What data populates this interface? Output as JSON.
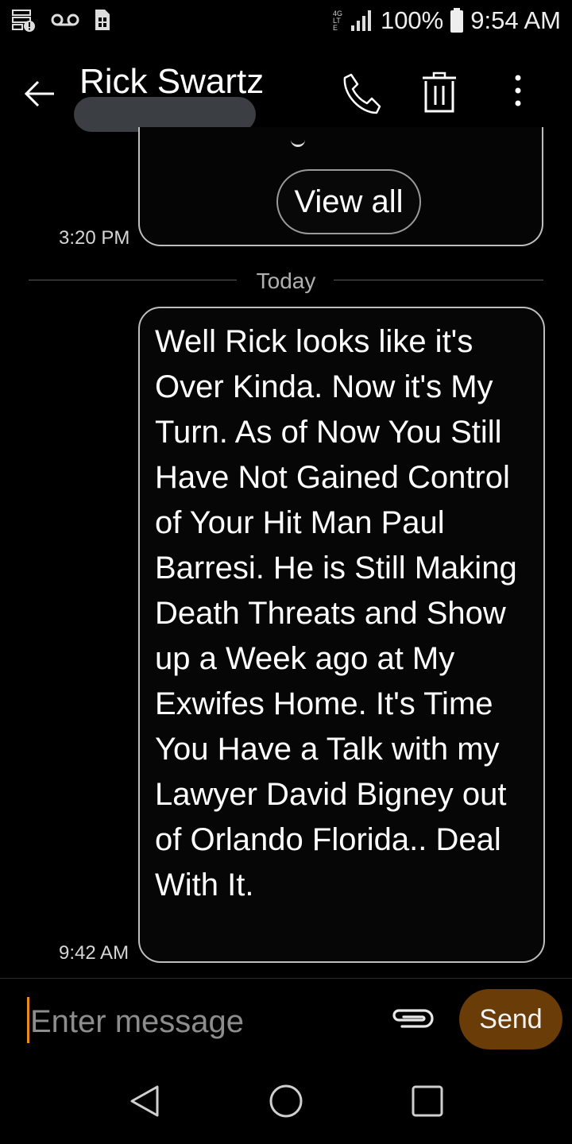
{
  "status_bar": {
    "network_type": "4G LTE",
    "battery": "100%",
    "time": "9:54 AM"
  },
  "header": {
    "contact_name": "Rick Swartz"
  },
  "conversation": {
    "previous_message": {
      "view_all_label": "View all",
      "time": "3:20 PM"
    },
    "date_divider": "Today",
    "message": {
      "text": "Well Rick looks like it's Over Kinda. Now it's My Turn. As of Now You Still Have Not Gained Control of Your Hit Man Paul Barresi. He is Still Making Death Threats and Show up a Week ago at My Exwifes Home. It's Time You Have a Talk with my Lawyer David Bigney out of Orlando Florida.. Deal With It.",
      "time": "9:42 AM"
    }
  },
  "composer": {
    "placeholder": "Enter message",
    "send_label": "Send",
    "cursor_color": "#e88a1c",
    "send_color": "#6a3c08"
  },
  "icons": {
    "status": [
      "server-alert-icon",
      "voicemail-icon",
      "sim-card-icon",
      "signal-icon",
      "battery-icon"
    ],
    "header": [
      "back-arrow-icon",
      "phone-icon",
      "trash-icon",
      "more-vert-icon"
    ],
    "composer": [
      "attachment-icon"
    ],
    "nav": [
      "nav-back-icon",
      "nav-home-icon",
      "nav-recents-icon"
    ]
  }
}
